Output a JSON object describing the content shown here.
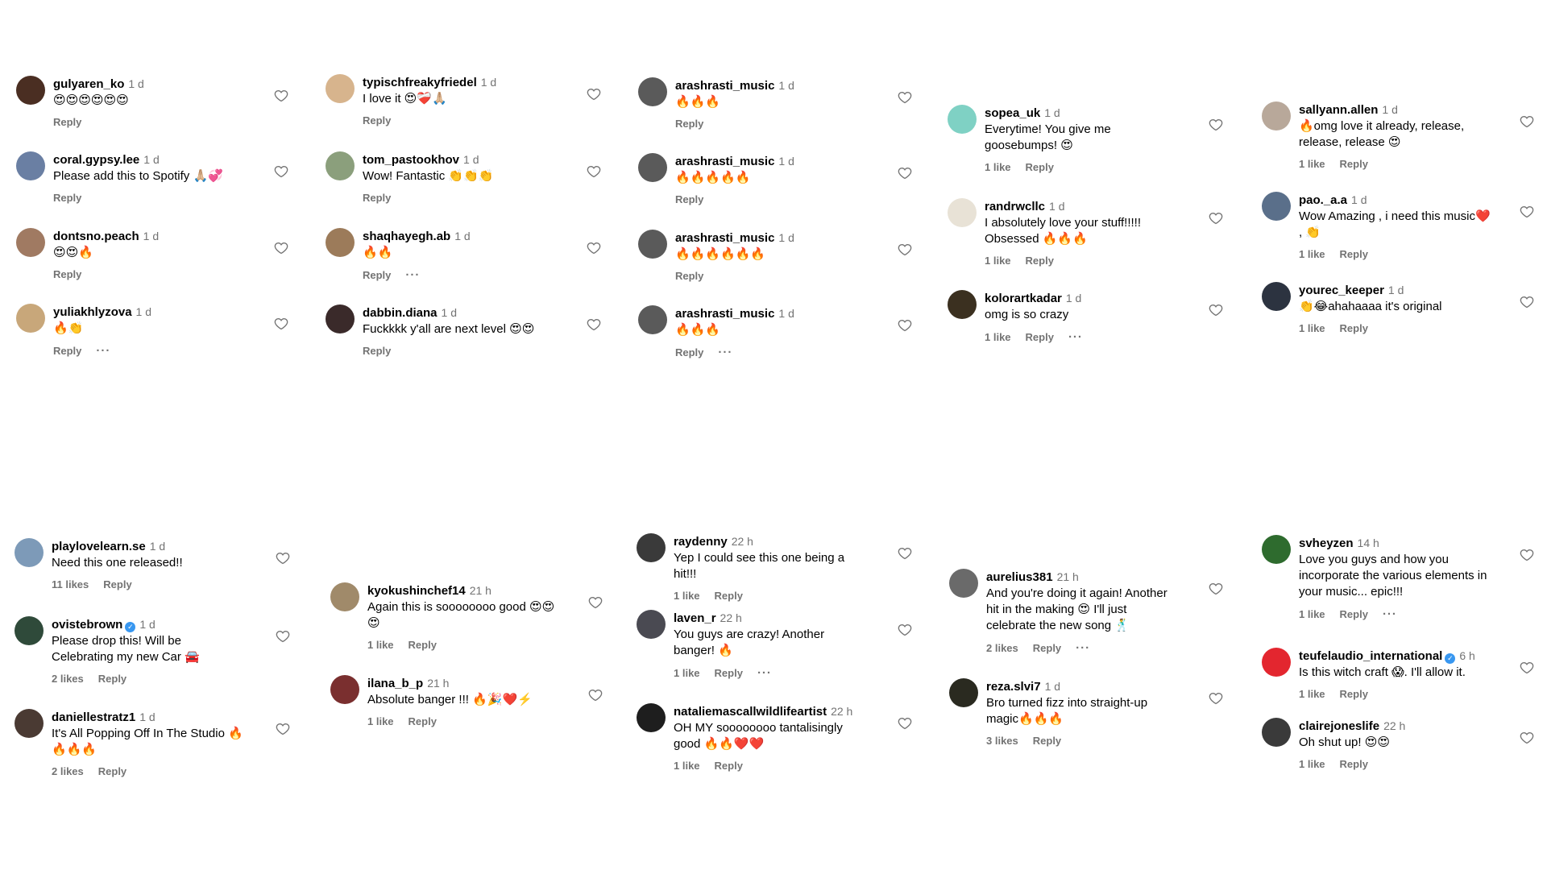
{
  "labels": {
    "reply": "Reply",
    "more": "···",
    "verified": "✓"
  },
  "columns": [
    {
      "comments": [
        {
          "user": "gulyaren_ko",
          "time": "1 d",
          "text": "😍😍😍😍😍😍",
          "likes": "",
          "more": false,
          "avatar": "#4a2e22"
        },
        {
          "user": "coral.gypsy.lee",
          "time": "1 d",
          "text": "Please add this to Spotify 🙏🏼💞",
          "likes": "",
          "more": false,
          "avatar": "#6a7fa3"
        },
        {
          "user": "dontsno.peach",
          "time": "1 d",
          "text": "😍😍🔥",
          "likes": "",
          "more": false,
          "avatar": "#a07a62"
        },
        {
          "user": "yuliakhlyzova",
          "time": "1 d",
          "text": "🔥👏",
          "likes": "",
          "more": true,
          "avatar": "#c8a77a"
        }
      ]
    },
    {
      "comments": [
        {
          "user": "typischfreakyfriedel",
          "time": "1 d",
          "text": "I love it 😍❤️‍🩹🙏🏼",
          "likes": "",
          "more": false,
          "avatar": "#d7b48d"
        },
        {
          "user": "tom_pastookhov",
          "time": "1 d",
          "text": "Wow! Fantastic 👏👏👏",
          "likes": "",
          "more": false,
          "avatar": "#8b9f7c"
        },
        {
          "user": "shaqhayegh.ab",
          "time": "1 d",
          "text": "🔥🔥",
          "likes": "",
          "more": true,
          "avatar": "#9c7b5a"
        },
        {
          "user": "dabbin.diana",
          "time": "1 d",
          "text": "Fuckkkk y'all are next level 😍😍",
          "likes": "",
          "more": false,
          "avatar": "#3a2a2a"
        }
      ]
    },
    {
      "comments": [
        {
          "user": "arashrasti_music",
          "time": "1 d",
          "text": "🔥🔥🔥",
          "likes": "",
          "more": false,
          "avatar": "#5a5a5a"
        },
        {
          "user": "arashrasti_music",
          "time": "1 d",
          "text": "🔥🔥🔥🔥🔥",
          "likes": "",
          "more": false,
          "avatar": "#5a5a5a"
        },
        {
          "user": "arashrasti_music",
          "time": "1 d",
          "text": "🔥🔥🔥🔥🔥🔥",
          "likes": "",
          "more": false,
          "avatar": "#5a5a5a"
        },
        {
          "user": "arashrasti_music",
          "time": "1 d",
          "text": "🔥🔥🔥",
          "likes": "",
          "more": true,
          "avatar": "#5a5a5a"
        }
      ]
    },
    {
      "comments": [
        {
          "user": "sopea_uk",
          "time": "1 d",
          "text": "Everytime! You give me goosebumps! 😍",
          "likes": "1 like",
          "more": false,
          "avatar": "#7fd1c4"
        },
        {
          "user": "randrwcllc",
          "time": "1 d",
          "text": "I absolutely love your stuff!!!!! Obsessed 🔥🔥🔥",
          "likes": "1 like",
          "more": false,
          "avatar": "#e8e2d6"
        },
        {
          "user": "kolorartkadar",
          "time": "1 d",
          "text": "omg is so crazy",
          "likes": "1 like",
          "more": true,
          "avatar": "#3b3020"
        }
      ]
    },
    {
      "comments": [
        {
          "user": "sallyann.allen",
          "time": "1 d",
          "text": "🔥omg love it already, release, release, release 😍",
          "likes": "1 like",
          "more": false,
          "avatar": "#b8a89a"
        },
        {
          "user": "pao._a.a",
          "time": "1 d",
          "text": "Wow Amazing , i need this music❤️ , 👏",
          "likes": "1 like",
          "more": false,
          "avatar": "#5a6f8a"
        },
        {
          "user": "yourec_keeper",
          "time": "1 d",
          "text": "👏😂ahahaaaa it's original",
          "likes": "1 like",
          "more": false,
          "avatar": "#2c3340"
        }
      ]
    },
    {
      "comments": [
        {
          "user": "playlovelearn.se",
          "time": "1 d",
          "text": "Need this one released!!",
          "likes": "11 likes",
          "more": false,
          "verified": false,
          "avatar": "#7d9ab8"
        },
        {
          "user": "ovistebrown",
          "time": "1 d",
          "text": "Please drop this! Will be Celebrating my new Car 🚘",
          "likes": "2 likes",
          "more": false,
          "verified": true,
          "avatar": "#2f4a3a"
        },
        {
          "user": "daniellestratz1",
          "time": "1 d",
          "text": "It's All Popping Off In The Studio 🔥🔥🔥🔥",
          "likes": "2 likes",
          "more": false,
          "verified": false,
          "avatar": "#4a3a33"
        }
      ]
    },
    {
      "comments": [
        {
          "user": "kyokushinchef14",
          "time": "21 h",
          "text": "Again this is soooooooo good 😍😍😍",
          "likes": "1 like",
          "more": false,
          "avatar": "#a08a6a"
        },
        {
          "user": "ilana_b_p",
          "time": "21 h",
          "text": "Absolute banger !!! 🔥🎉❤️⚡️",
          "likes": "1 like",
          "more": false,
          "avatar": "#7a2f2f"
        }
      ]
    },
    {
      "comments": [
        {
          "user": "raydenny",
          "time": "22 h",
          "text": "Yep I could see this one being a hit!!!",
          "likes": "1 like",
          "more": false,
          "avatar": "#3a3a3a"
        },
        {
          "user": "laven_r",
          "time": "22 h",
          "text": "You guys are crazy! Another banger! 🔥",
          "likes": "1 like",
          "more": true,
          "avatar": "#4a4a52"
        },
        {
          "user": "nataliemascallwildlifeartist",
          "time": "22 h",
          "text": "OH MY soooooooo tantalisingly good 🔥🔥❤️❤️",
          "likes": "1 like",
          "more": false,
          "avatar": "#1e1e1e"
        }
      ]
    },
    {
      "comments": [
        {
          "user": "aurelius381",
          "time": "21 h",
          "text": "And you're doing it again! Another hit in the making 😍 I'll just celebrate the new song 🕺",
          "likes": "2 likes",
          "more": true,
          "avatar": "#6a6a6a"
        },
        {
          "user": "reza.slvi7",
          "time": "1 d",
          "text": "Bro turned fizz into straight-up magic🔥🔥🔥",
          "likes": "3 likes",
          "more": false,
          "avatar": "#2a2a20"
        }
      ]
    },
    {
      "comments": [
        {
          "user": "svheyzen",
          "time": "14 h",
          "text": "Love you guys and how you incorporate the various elements in your music... epic!!!",
          "likes": "1 like",
          "more": true,
          "verified": false,
          "avatar": "#2e6b2e"
        },
        {
          "user": "teufelaudio_international",
          "time": "6 h",
          "text": "Is this witch craft 😱. I'll allow it.",
          "likes": "1 like",
          "more": false,
          "verified": true,
          "avatar": "#e3262f"
        },
        {
          "user": "clairejoneslife",
          "time": "22 h",
          "text": "Oh shut up! 😍😍",
          "likes": "1 like",
          "more": false,
          "verified": false,
          "avatar": "#3a3a3a"
        }
      ]
    }
  ]
}
